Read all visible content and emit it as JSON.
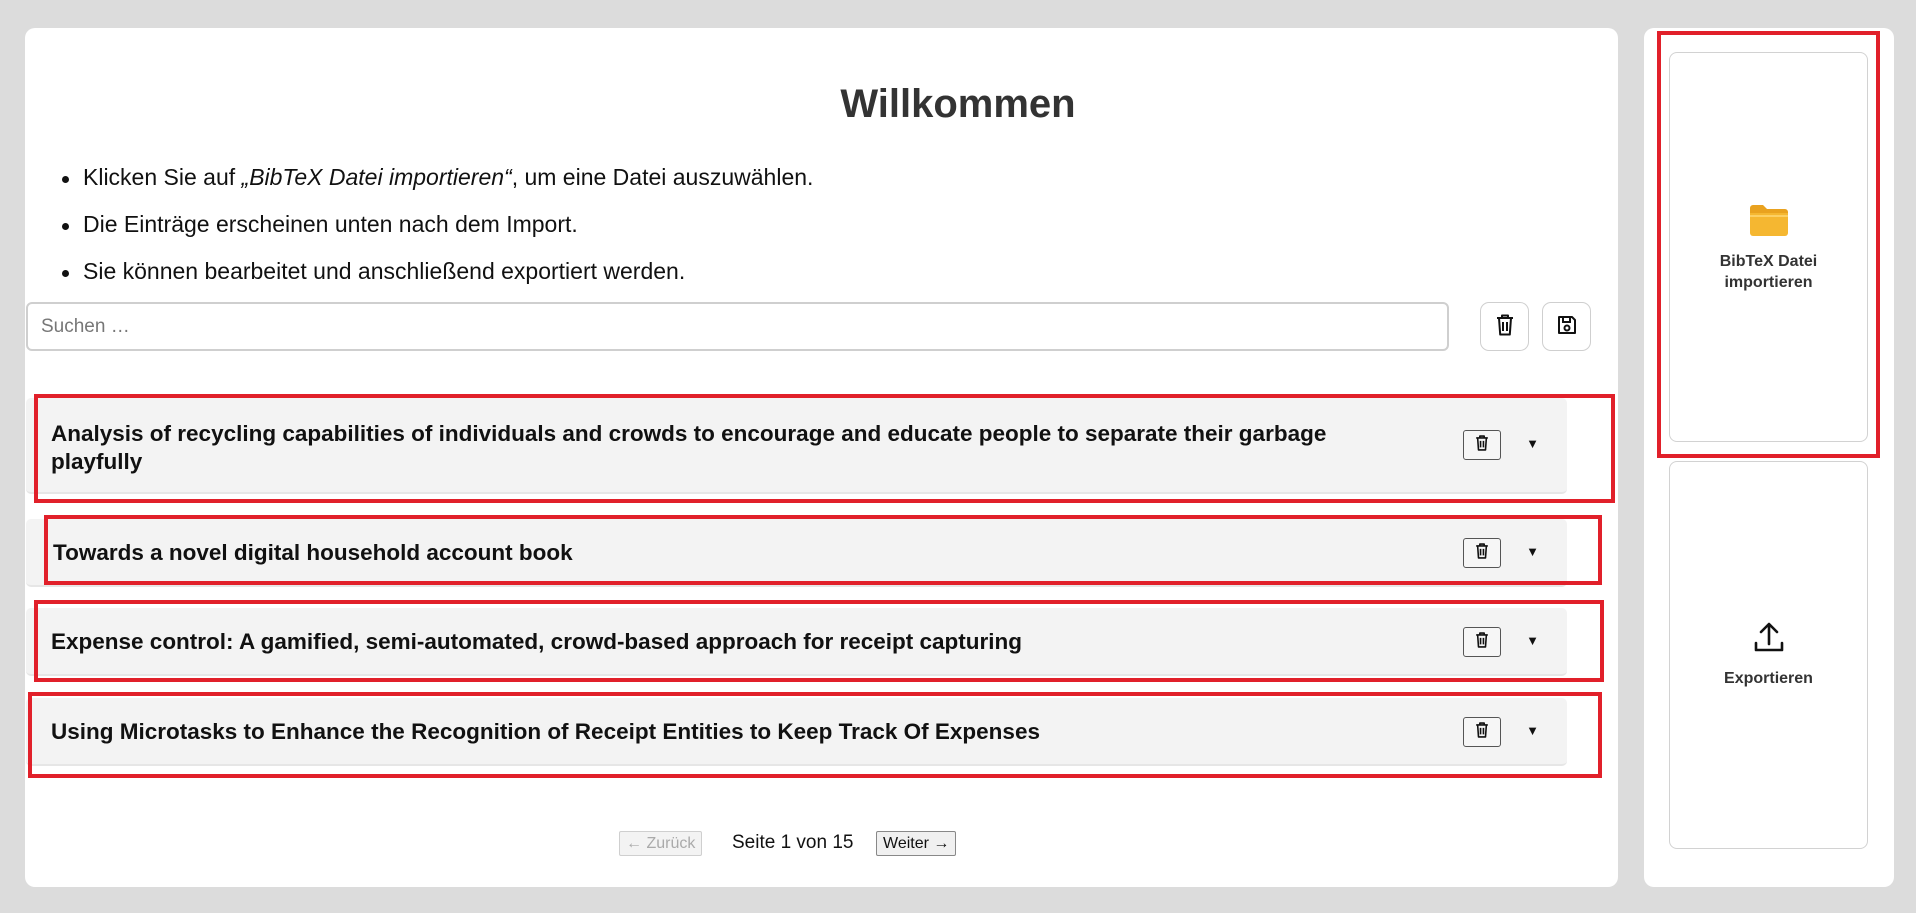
{
  "welcome": {
    "title": "Willkommen",
    "instructions": [
      {
        "before": "Klicken Sie auf ",
        "em": "„BibTeX Datei importieren“",
        "after": ", um eine Datei auszuwählen."
      },
      {
        "text": "Die Einträge erscheinen unten nach dem Import."
      },
      {
        "text": "Sie können bearbeitet und anschließend exportiert werden."
      }
    ]
  },
  "search": {
    "placeholder": "Suchen …"
  },
  "toolbar": {
    "delete_icon": "trash-icon",
    "save_icon": "floppy-disk-icon"
  },
  "entries": [
    {
      "title": "Analysis of recycling capabilities of individuals and crowds to encourage and educate people to separate their garbage playfully"
    },
    {
      "title": "Towards a novel digital household account book"
    },
    {
      "title": "Expense control: A gamified, semi-automated, crowd-based approach for receipt capturing"
    },
    {
      "title": "Using Microtasks to Enhance the Recognition of Receipt Entities to Keep Track Of Expenses"
    }
  ],
  "pagination": {
    "prev_label": "← Zurück",
    "info": "Seite 1 von 15",
    "next_label": "Weiter →"
  },
  "sidebar": {
    "import_label": "BibTeX Datei importieren",
    "import_icon": "folder-icon",
    "export_label": "Exportieren",
    "export_icon": "upload-icon"
  },
  "colors": {
    "highlight": "#e1202a",
    "folder": "#f5b731"
  }
}
